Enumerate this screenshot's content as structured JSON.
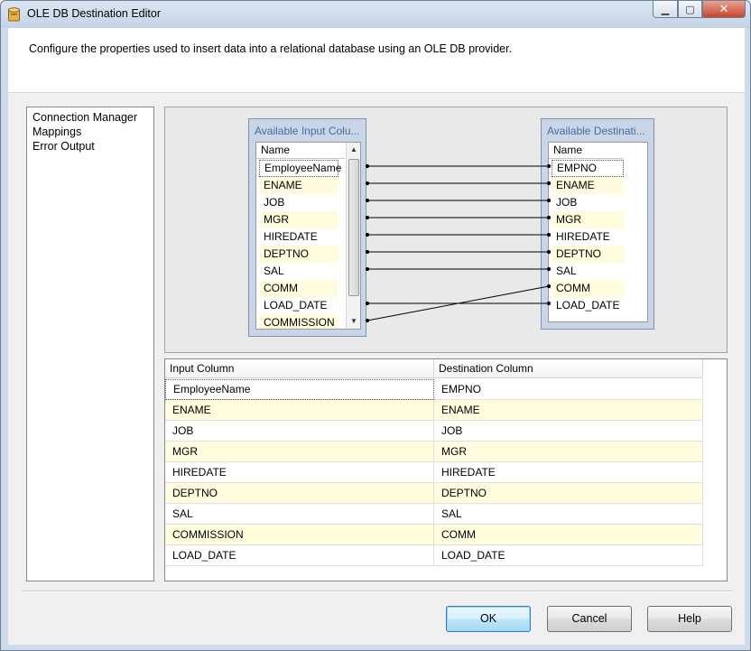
{
  "window": {
    "title": "OLE DB Destination Editor"
  },
  "header": {
    "description": "Configure the properties used to insert data into a relational database using an OLE DB provider."
  },
  "nav": {
    "items": [
      "Connection Manager",
      "Mappings",
      "Error Output"
    ]
  },
  "input_box": {
    "title": "Available Input Colu...",
    "header": "Name",
    "items": [
      "EmployeeName",
      "ENAME",
      "JOB",
      "MGR",
      "HIREDATE",
      "DEPTNO",
      "SAL",
      "COMM",
      "LOAD_DATE",
      "COMMISSION"
    ]
  },
  "dest_box": {
    "title": "Available Destinati...",
    "header": "Name",
    "items": [
      "EMPNO",
      "ENAME",
      "JOB",
      "MGR",
      "HIREDATE",
      "DEPTNO",
      "SAL",
      "COMM",
      "LOAD_DATE"
    ]
  },
  "grid": {
    "headers": [
      "Input Column",
      "Destination Column"
    ],
    "rows": [
      [
        "EmployeeName",
        "EMPNO"
      ],
      [
        "ENAME",
        "ENAME"
      ],
      [
        "JOB",
        "JOB"
      ],
      [
        "MGR",
        "MGR"
      ],
      [
        "HIREDATE",
        "HIREDATE"
      ],
      [
        "DEPTNO",
        "DEPTNO"
      ],
      [
        "SAL",
        "SAL"
      ],
      [
        "COMMISSION",
        "COMM"
      ],
      [
        "LOAD_DATE",
        "LOAD_DATE"
      ]
    ]
  },
  "buttons": {
    "ok": "OK",
    "cancel": "Cancel",
    "help": "Help"
  },
  "icons": {
    "app": "database-icon",
    "minimize": "minimize-icon",
    "maximize": "maximize-icon",
    "close": "close-icon"
  }
}
